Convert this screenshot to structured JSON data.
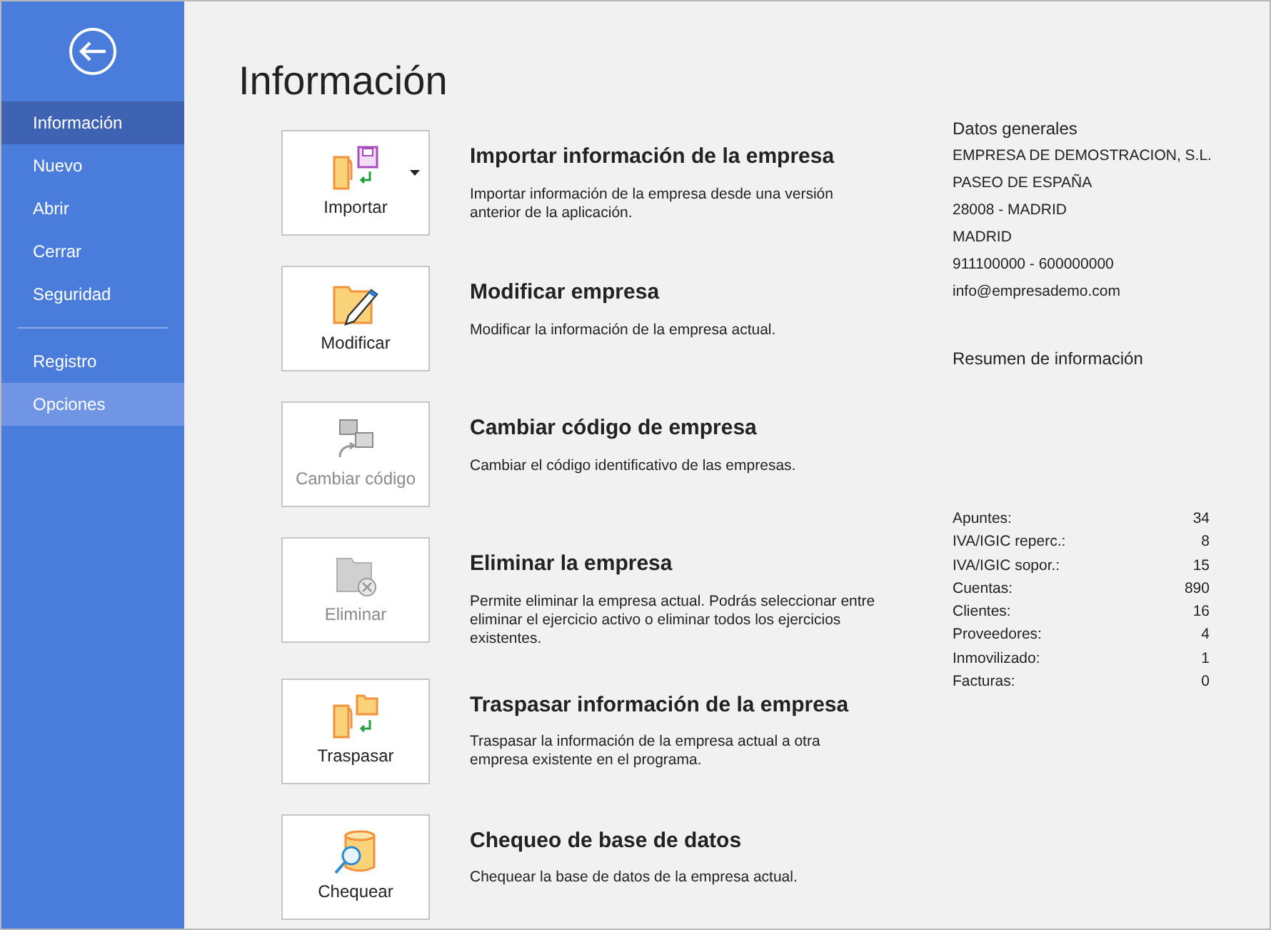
{
  "sidebar": {
    "groups": [
      {
        "items": [
          {
            "label": "Información",
            "selected": true,
            "hovered": false
          },
          {
            "label": "Nuevo",
            "selected": false,
            "hovered": false
          },
          {
            "label": "Abrir",
            "selected": false,
            "hovered": false
          },
          {
            "label": "Cerrar",
            "selected": false,
            "hovered": false
          },
          {
            "label": "Seguridad",
            "selected": false,
            "hovered": false
          }
        ]
      },
      {
        "items": [
          {
            "label": "Registro",
            "selected": false,
            "hovered": false
          },
          {
            "label": "Opciones",
            "selected": false,
            "hovered": true
          }
        ]
      }
    ]
  },
  "title": "Información",
  "actions": [
    {
      "kind": "import",
      "label": "Importar",
      "disabled": false,
      "dropdown": true,
      "heading": "Importar información de la empresa",
      "description": "Importar información de la empresa desde una versión anterior de la aplicación."
    },
    {
      "kind": "modify",
      "label": "Modificar",
      "disabled": false,
      "dropdown": false,
      "heading": "Modificar empresa",
      "description": "Modificar la información de la empresa actual."
    },
    {
      "kind": "code",
      "label": "Cambiar código",
      "disabled": true,
      "dropdown": false,
      "heading": "Cambiar código de empresa",
      "description": "Cambiar el código identificativo de las empresas."
    },
    {
      "kind": "delete",
      "label": "Eliminar",
      "disabled": true,
      "dropdown": false,
      "heading": "Eliminar la empresa",
      "description": "Permite eliminar la empresa actual. Podrás seleccionar entre eliminar el ejercicio activo o eliminar todos los ejercicios existentes."
    },
    {
      "kind": "transfer",
      "label": "Traspasar",
      "disabled": false,
      "dropdown": false,
      "heading": "Traspasar información de la empresa",
      "description": "Traspasar la información de la empresa actual a otra empresa existente en el programa."
    },
    {
      "kind": "check",
      "label": "Chequear",
      "disabled": false,
      "dropdown": false,
      "heading": "Chequeo de base de datos",
      "description": "Chequear la base de datos de la empresa actual."
    }
  ],
  "general": {
    "heading": "Datos generales",
    "lines": [
      "EMPRESA DE DEMOSTRACION, S.L.",
      "PASEO DE ESPAÑA",
      "28008 - MADRID",
      "MADRID",
      "911100000 - 600000000",
      "info@empresademo.com"
    ]
  },
  "summary": {
    "heading": "Resumen de información",
    "rows": [
      {
        "label": "Apuntes:",
        "value": "34"
      },
      {
        "label": "IVA/IGIC reperc.:",
        "value": "8"
      },
      {
        "label": "IVA/IGIC sopor.:",
        "value": "15"
      },
      {
        "label": "Cuentas:",
        "value": "890"
      },
      {
        "label": "Clientes:",
        "value": "16"
      },
      {
        "label": "Proveedores:",
        "value": "4"
      },
      {
        "label": "Inmovilizado:",
        "value": "1"
      },
      {
        "label": "Facturas:",
        "value": "0"
      }
    ]
  }
}
